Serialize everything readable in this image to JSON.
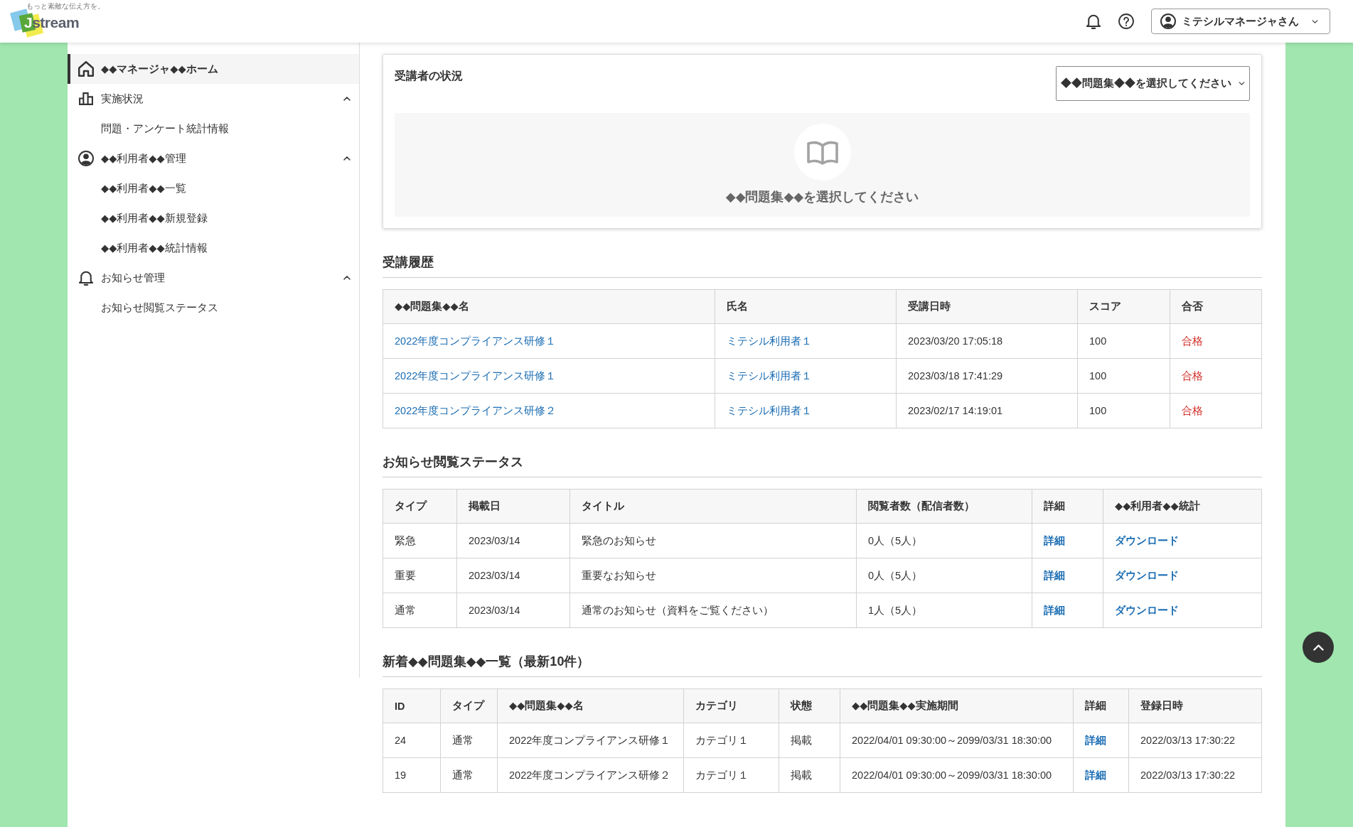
{
  "header": {
    "logo": {
      "tagline": "もっと素敵な伝え方を。",
      "wordmark": "Jstream"
    },
    "user_menu": {
      "label": "ミテシルマネージャさん"
    }
  },
  "sidebar": {
    "items": [
      {
        "label": "◆◆マネージャ◆◆ホーム",
        "selected": true
      },
      {
        "label": "実施状況",
        "selected": false,
        "expanded": true,
        "children": [
          {
            "label": "問題・アンケート統計情報",
            "selected": false
          }
        ]
      },
      {
        "label": "◆◆利用者◆◆管理",
        "selected": false,
        "expanded": true,
        "children": [
          {
            "label": "◆◆利用者◆◆一覧",
            "selected": false
          },
          {
            "label": "◆◆利用者◆◆新規登録",
            "selected": false
          },
          {
            "label": "◆◆利用者◆◆統計情報",
            "selected": false
          }
        ]
      },
      {
        "label": "お知らせ管理",
        "selected": false,
        "expanded": true,
        "children": [
          {
            "label": "お知らせ閲覧ステータス",
            "selected": false
          }
        ]
      }
    ]
  },
  "learner_status": {
    "title": "受講者の状況",
    "select": {
      "placeholder": "◆◆問題集◆◆を選択してください"
    },
    "empty_message": "◆◆問題集◆◆を選択してください"
  },
  "sections": [
    {
      "title": "受講履歴",
      "table": {
        "columns": [
          {
            "label": "◆◆問題集◆◆名",
            "kind": "link"
          },
          {
            "label": "氏名",
            "kind": "link"
          },
          {
            "label": "受講日時",
            "kind": "text"
          },
          {
            "label": "スコア",
            "kind": "text"
          },
          {
            "label": "合否",
            "kind": "result"
          }
        ],
        "rows": [
          [
            "2022年度コンプライアンス研修１",
            "ミテシル利用者１",
            "2023/03/20 17:05:18",
            "100",
            "合格"
          ],
          [
            "2022年度コンプライアンス研修１",
            "ミテシル利用者１",
            "2023/03/18 17:41:29",
            "100",
            "合格"
          ],
          [
            "2022年度コンプライアンス研修２",
            "ミテシル利用者１",
            "2023/02/17 14:19:01",
            "100",
            "合格"
          ]
        ]
      }
    },
    {
      "title": "お知らせ閲覧ステータス",
      "table": {
        "columns": [
          {
            "label": "タイプ",
            "kind": "text"
          },
          {
            "label": "掲載日",
            "kind": "text"
          },
          {
            "label": "タイトル",
            "kind": "text"
          },
          {
            "label": "閲覧者数（配信者数）",
            "kind": "text"
          },
          {
            "label": "詳細",
            "kind": "action"
          },
          {
            "label": "◆◆利用者◆◆統計",
            "kind": "action"
          }
        ],
        "rows": [
          [
            "緊急",
            "2023/03/14",
            "緊急のお知らせ",
            "0人（5人）",
            "詳細",
            "ダウンロード"
          ],
          [
            "重要",
            "2023/03/14",
            "重要なお知らせ",
            "0人（5人）",
            "詳細",
            "ダウンロード"
          ],
          [
            "通常",
            "2023/03/14",
            "通常のお知らせ（資料をご覧ください）",
            "1人（5人）",
            "詳細",
            "ダウンロード"
          ]
        ]
      }
    },
    {
      "title": "新着◆◆問題集◆◆一覧（最新10件）",
      "table": {
        "columns": [
          {
            "label": "ID",
            "kind": "text"
          },
          {
            "label": "タイプ",
            "kind": "text"
          },
          {
            "label": "◆◆問題集◆◆名",
            "kind": "text"
          },
          {
            "label": "カテゴリ",
            "kind": "text"
          },
          {
            "label": "状態",
            "kind": "text"
          },
          {
            "label": "◆◆問題集◆◆実施期間",
            "kind": "text"
          },
          {
            "label": "詳細",
            "kind": "action"
          },
          {
            "label": "登録日時",
            "kind": "text"
          }
        ],
        "rows": [
          [
            "24",
            "通常",
            "2022年度コンプライアンス研修１",
            "カテゴリ１",
            "掲載",
            "2022/04/01 09:30:00～2099/03/31 18:30:00",
            "詳細",
            "2022/03/13 17:30:22"
          ],
          [
            "19",
            "通常",
            "2022年度コンプライアンス研修２",
            "カテゴリ１",
            "掲載",
            "2022/04/01 09:30:00～2099/03/31 18:30:00",
            "詳細",
            "2022/03/13 17:30:22"
          ]
        ]
      }
    }
  ]
}
